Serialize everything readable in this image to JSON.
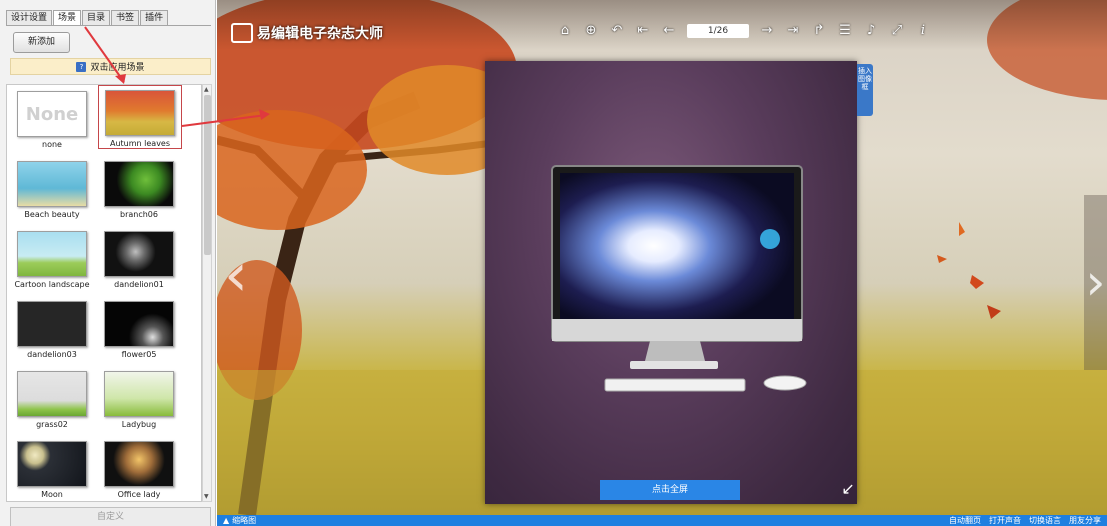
{
  "left_panel": {
    "tabs": [
      "设计设置",
      "场景",
      "目录",
      "书签",
      "插件"
    ],
    "active_tab": "场景",
    "add_new_button": "新添加",
    "hint_text": "双击应用场景",
    "scenes": [
      {
        "label": "none",
        "thumb": "None"
      },
      {
        "label": "Autumn leaves",
        "selected": true
      },
      {
        "label": "Beach beauty"
      },
      {
        "label": "branch06"
      },
      {
        "label": "Cartoon landscape"
      },
      {
        "label": "dandelion01"
      },
      {
        "label": "dandelion03"
      },
      {
        "label": "flower05"
      },
      {
        "label": "grass02"
      },
      {
        "label": "Ladybug"
      },
      {
        "label": "Moon"
      },
      {
        "label": "Office lady"
      }
    ],
    "custom_button": "自定义"
  },
  "stage": {
    "logo_text": "易编辑电子杂志大师",
    "page_indicator": "1/26",
    "book_side_tab": "插入图像框",
    "fullscreen_button": "点击全屏"
  },
  "bottom_bar": {
    "thumbnails_label": "缩略图",
    "auto_flip": "自动翻页",
    "sound": "打开声音",
    "language": "切换语言",
    "share": "朋友分享"
  },
  "colors": {
    "accent_blue": "#1e7fe0",
    "highlight_red": "#e0393e"
  }
}
